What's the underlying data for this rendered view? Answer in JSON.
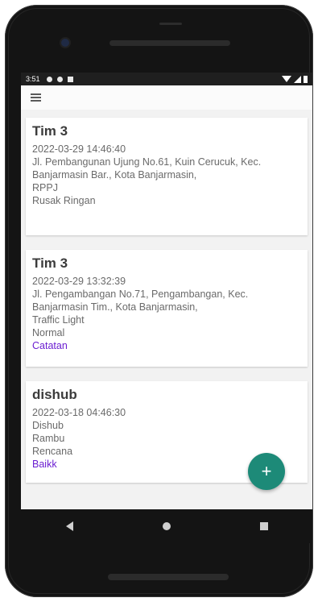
{
  "statusbar": {
    "time": "3:51"
  },
  "reports": [
    {
      "title": "Tim 3",
      "datetime": "2022-03-29 14:46:40",
      "address": "Jl. Pembangunan Ujung No.61, Kuin Cerucuk, Kec. Banjarmasin Bar., Kota Banjarmasin,",
      "type": "RPPJ",
      "status": "Rusak Ringan"
    },
    {
      "title": "Tim 3",
      "datetime": "2022-03-29 13:32:39",
      "address": "Jl. Pengambangan No.71, Pengambangan, Kec. Banjarmasin Tim., Kota Banjarmasin,",
      "type": "Traffic Light",
      "status": "Normal",
      "note": "Catatan"
    },
    {
      "title": "dishub",
      "datetime": "2022-03-18 04:46:30",
      "address": "Dishub",
      "type": "Rambu",
      "status": "Rencana",
      "note": "Baikk"
    }
  ],
  "fab": {
    "label": "+"
  },
  "icons": {
    "menu": "menu-icon",
    "add": "add-icon",
    "back": "back-icon",
    "home": "home-icon",
    "recents": "recents-icon"
  },
  "colors": {
    "fab": "#1d8a78",
    "link": "#6b1ed1",
    "statusbar": "#1f1f1f"
  }
}
